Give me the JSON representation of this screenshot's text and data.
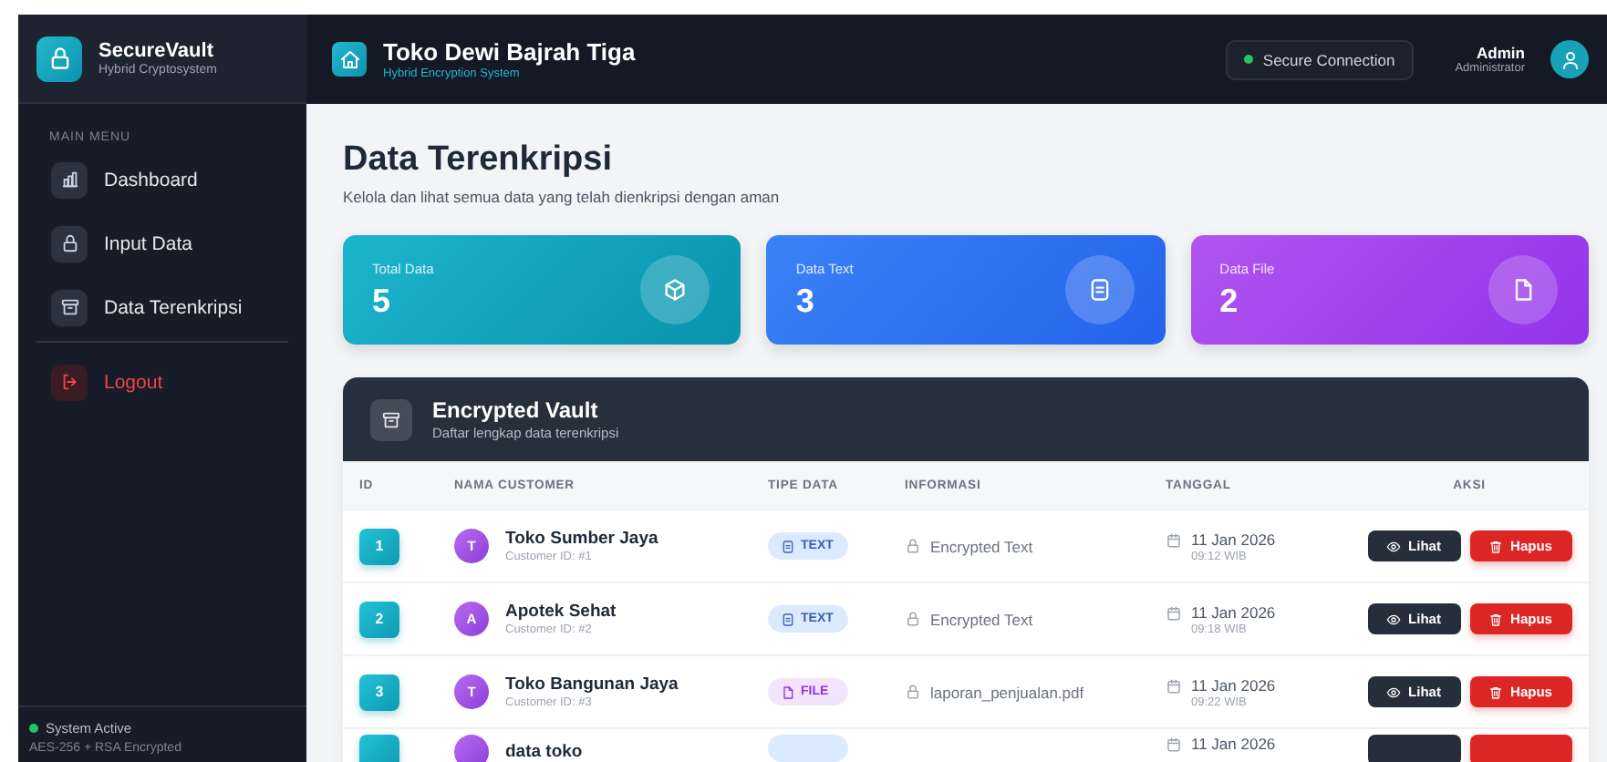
{
  "sidebar": {
    "brand": {
      "title": "SecureVault",
      "subtitle": "Hybrid Cryptosystem"
    },
    "section_label": "MAIN MENU",
    "items": [
      {
        "label": "Dashboard",
        "kind": "chart",
        "selected": false
      },
      {
        "label": "Input Data",
        "kind": "lock",
        "selected": false
      },
      {
        "label": "Data Terenkripsi",
        "kind": "archive",
        "selected": false
      },
      {
        "label": "Logout",
        "kind": "logout",
        "selected": false
      }
    ],
    "footer": {
      "status": "System Active",
      "detail": "AES-256 + RSA Encrypted"
    }
  },
  "topbar": {
    "title": "Toko Dewi Bajrah Tiga",
    "subtitle": "Hybrid Encryption System",
    "connection": "Secure Connection",
    "user": {
      "name": "Admin",
      "role": "Administrator"
    }
  },
  "page": {
    "title": "Data Terenkripsi",
    "subtitle": "Kelola dan lihat semua data yang telah dienkripsi dengan aman"
  },
  "stats": [
    {
      "label": "Total Data",
      "value": "5",
      "kind": "total"
    },
    {
      "label": "Data Text",
      "value": "3",
      "kind": "text"
    },
    {
      "label": "Data File",
      "value": "2",
      "kind": "file"
    }
  ],
  "vault": {
    "title": "Encrypted Vault",
    "subtitle": "Daftar lengkap data terenkripsi",
    "columns": [
      "ID",
      "NAMA CUSTOMER",
      "TIPE DATA",
      "INFORMASI",
      "TANGGAL",
      "AKSI"
    ],
    "rows": [
      {
        "id": "1",
        "initial": "T",
        "name": "Toko Sumber Jaya",
        "customer_id": "Customer ID: #1",
        "kind": "text",
        "type_label": "TEXT",
        "info": "Encrypted Text",
        "date": "11 Jan 2026",
        "time": "09:12 WIB",
        "view": "Lihat",
        "delete": "Hapus"
      },
      {
        "id": "2",
        "initial": "A",
        "name": "Apotek Sehat",
        "customer_id": "Customer ID: #2",
        "kind": "text",
        "type_label": "TEXT",
        "info": "Encrypted Text",
        "date": "11 Jan 2026",
        "time": "09:18 WIB",
        "view": "Lihat",
        "delete": "Hapus"
      },
      {
        "id": "3",
        "initial": "T",
        "name": "Toko Bangunan Jaya",
        "customer_id": "Customer ID: #3",
        "kind": "file",
        "type_label": "FILE",
        "info": "laporan_penjualan.pdf",
        "date": "11 Jan 2026",
        "time": "09:22 WIB",
        "view": "Lihat",
        "delete": "Hapus"
      },
      {
        "name": "data toko",
        "kind": "text",
        "date": "11 Jan 2026"
      }
    ]
  }
}
